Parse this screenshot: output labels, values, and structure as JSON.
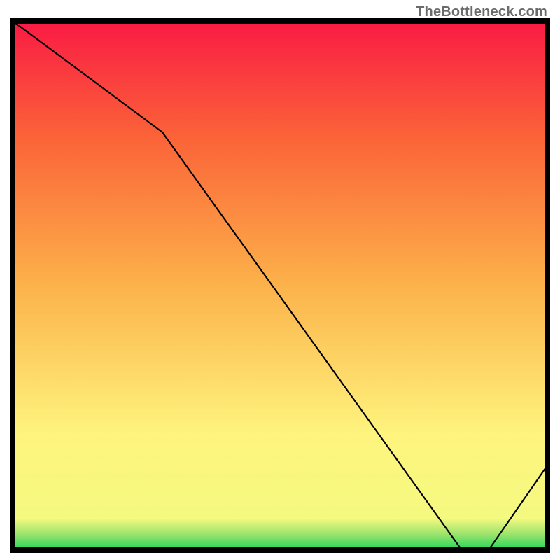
{
  "watermark": "TheBottleneck.com",
  "chart_data": {
    "type": "line",
    "title": "",
    "xlabel": "",
    "ylabel": "",
    "xlim": [
      0,
      100
    ],
    "ylim": [
      0,
      100
    ],
    "x": [
      0,
      28,
      84,
      89,
      100
    ],
    "values": [
      100,
      79,
      0,
      0,
      16
    ],
    "gradient_stops": [
      {
        "offset": 0,
        "color": "#1fd65a"
      },
      {
        "offset": 3,
        "color": "#9be36c"
      },
      {
        "offset": 6,
        "color": "#f4f97f"
      },
      {
        "offset": 22,
        "color": "#fef47e"
      },
      {
        "offset": 50,
        "color": "#fcb24a"
      },
      {
        "offset": 78,
        "color": "#fb6338"
      },
      {
        "offset": 100,
        "color": "#fa1a44"
      }
    ],
    "minimum_label": {
      "text": "",
      "x": 86,
      "y": 1
    }
  }
}
